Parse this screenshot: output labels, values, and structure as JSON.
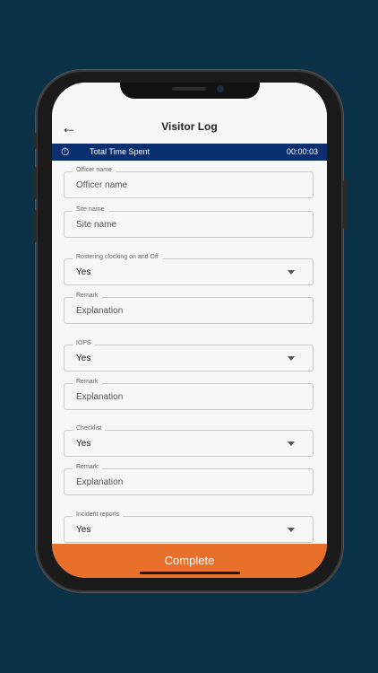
{
  "header": {
    "title": "Visitor Log",
    "back_icon": "arrow-left-icon"
  },
  "timer": {
    "label": "Total Time Spent",
    "value": "00:00:03",
    "icon": "stopwatch-icon"
  },
  "fields": [
    {
      "label": "Officer name",
      "value": "Officer name",
      "type": "input"
    },
    {
      "label": "Site name",
      "value": "Site name",
      "type": "input"
    },
    {
      "label": "Rostering clocking on and Off",
      "value": "Yes",
      "type": "select"
    },
    {
      "label": "Remark",
      "value": "Explanation",
      "type": "input"
    },
    {
      "label": "IOPS",
      "value": "Yes",
      "type": "select"
    },
    {
      "label": "Remark",
      "value": "Explanation",
      "type": "input"
    },
    {
      "label": "Checklist",
      "value": "Yes",
      "type": "select"
    },
    {
      "label": "Remark",
      "value": "Explanation",
      "type": "input"
    },
    {
      "label": "Incident reports",
      "value": "Yes",
      "type": "select"
    }
  ],
  "footer": {
    "complete_label": "Complete"
  },
  "colors": {
    "background": "#0b3147",
    "timer_bar": "#0b2f6e",
    "complete": "#e8702a"
  }
}
